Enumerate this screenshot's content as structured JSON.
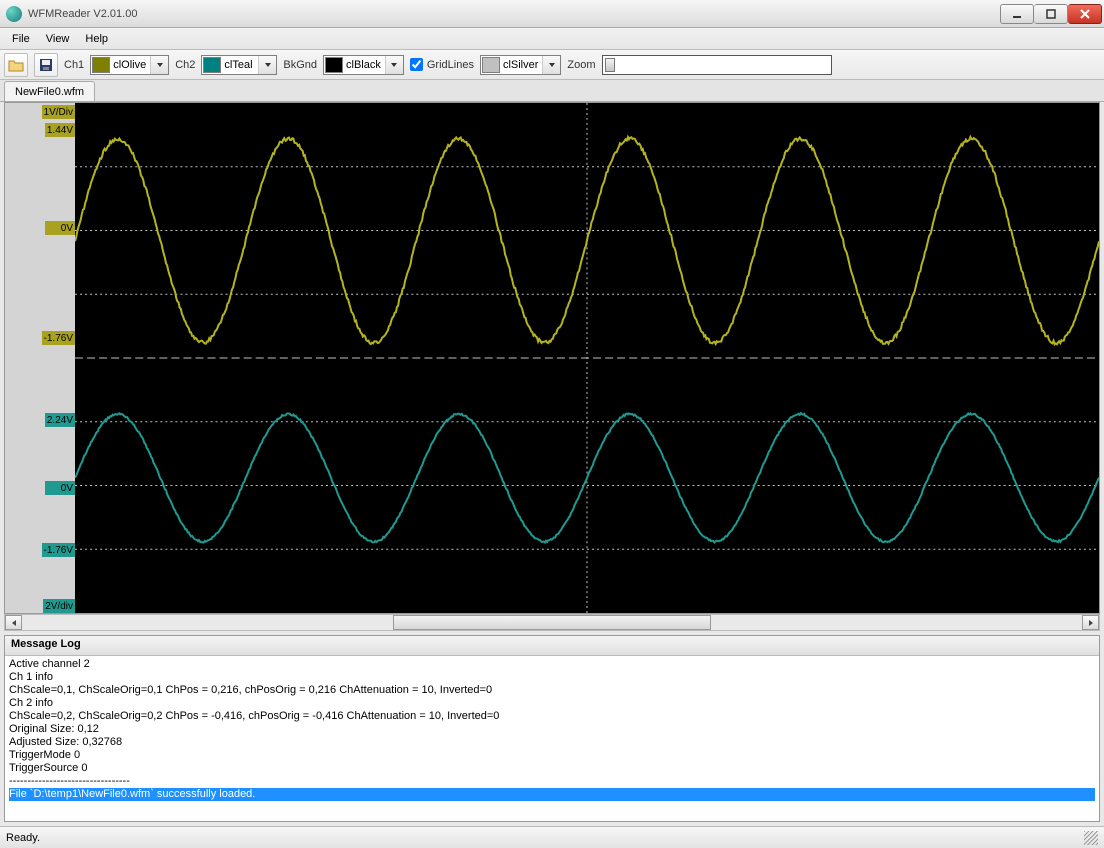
{
  "window": {
    "title": "WFMReader V2.01.00"
  },
  "menu": {
    "items": [
      "File",
      "View",
      "Help"
    ]
  },
  "toolbar": {
    "ch1_label": "Ch1",
    "ch1_select": {
      "swatch": "#808000",
      "text": "clOlive"
    },
    "ch2_label": "Ch2",
    "ch2_select": {
      "swatch": "#008080",
      "text": "clTeal"
    },
    "bkgnd_label": "BkGnd",
    "bkgnd_select": {
      "swatch": "#000000",
      "text": "clBlack"
    },
    "gridlines_label": "GridLines",
    "gridlines_checked": true,
    "gridlines_select": {
      "swatch": "#c0c0c0",
      "text": "clSilver"
    },
    "zoom_label": "Zoom"
  },
  "tabs": {
    "items": [
      "NewFile0.wfm"
    ]
  },
  "waveform": {
    "ch1": {
      "color": "#b4b320",
      "scale_label": "1V/Div",
      "max_label": "1.44V",
      "zero_label": "0V",
      "min_label": "-1.76V"
    },
    "ch2": {
      "color": "#1e9a90",
      "scale_label": "2V/div",
      "max_label": "2.24V",
      "zero_label": "0V",
      "min_label": "-1.76V"
    }
  },
  "chart_data": {
    "type": "line",
    "title": "",
    "xlabel": "",
    "ylabel": "",
    "x_divisions": 12,
    "gridlines": true,
    "background": "#000000",
    "series": [
      {
        "name": "Ch1",
        "color": "#b4b320",
        "volts_per_div": 1,
        "zero_position_div_from_top": 2,
        "amplitude_v": 1.6,
        "offset_v": -0.16,
        "max_v": 1.44,
        "min_v": -1.76,
        "cycles_visible": 6,
        "waveform": "sine",
        "approx_y_values": [
          -0.16,
          0.8,
          1.4,
          1.44,
          0.96,
          0.08,
          -0.8,
          -1.48,
          -1.76,
          -1.36,
          -0.56,
          0.4,
          1.16,
          1.44,
          1.2,
          0.4,
          -0.56,
          -1.36,
          -1.76,
          -1.48,
          -0.8,
          0.08,
          0.96,
          1.44
        ]
      },
      {
        "name": "Ch2",
        "color": "#1e9a90",
        "volts_per_div": 2,
        "zero_position_div_from_top": 6,
        "amplitude_v": 2.0,
        "offset_v": 0.24,
        "max_v": 2.24,
        "min_v": -1.76,
        "cycles_visible": 6,
        "waveform": "sine",
        "approx_y_values": [
          0.24,
          1.44,
          2.16,
          2.24,
          1.6,
          0.48,
          -0.72,
          -1.52,
          -1.76,
          -1.36,
          -0.4,
          0.8,
          1.84,
          2.24,
          1.92,
          0.88,
          -0.32,
          -1.28,
          -1.76,
          -1.6,
          -0.88,
          0.24,
          1.44,
          2.16
        ]
      }
    ]
  },
  "message_log": {
    "title": "Message Log",
    "lines": [
      "Active channel 2",
      "Ch 1 info",
      "ChScale=0,1, ChScaleOrig=0,1 ChPos = 0,216, chPosOrig = 0,216 ChAttenuation = 10, Inverted=0",
      "Ch 2 info",
      "ChScale=0,2, ChScaleOrig=0,2 ChPos = -0,416, chPosOrig = -0,416 ChAttenuation = 10, Inverted=0",
      "Original Size: 0,12",
      "Adjusted Size: 0,32768",
      "TriggerMode 0",
      "TriggerSource 0",
      "---------------------------------",
      "File `D:\\temp1\\NewFile0.wfm` successfully loaded."
    ],
    "selected_index": 10
  },
  "statusbar": {
    "text": "Ready."
  }
}
